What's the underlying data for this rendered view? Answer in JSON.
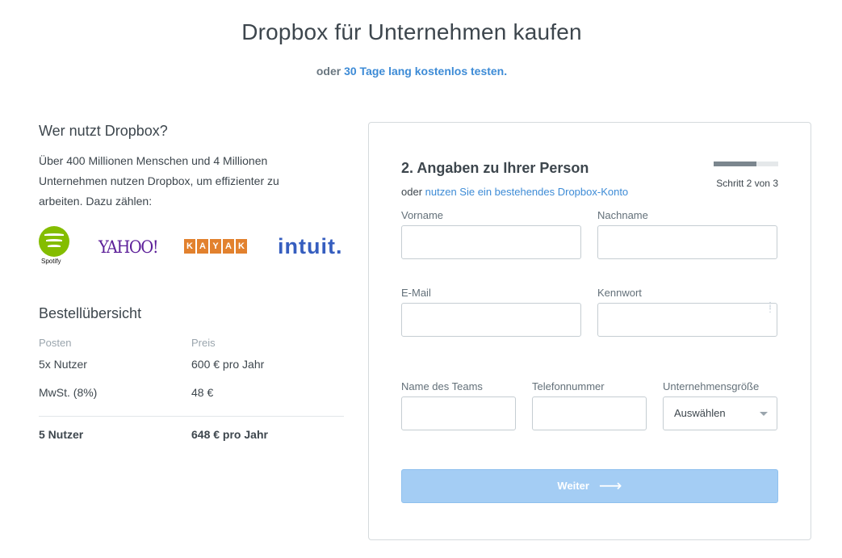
{
  "header": {
    "title": "Dropbox für Unternehmen kaufen",
    "subtitle_prefix": "oder",
    "subtitle_link": "30 Tage lang kostenlos testen."
  },
  "who": {
    "title": "Wer nutzt Dropbox?",
    "text": "Über 400 Millionen Menschen und 4 Millionen Unternehmen nutzen Dropbox, um effizienter zu arbeiten. Dazu zählen:",
    "logos": {
      "spotify": "Spotify",
      "yahoo": "YAHOO!",
      "kayak": [
        "K",
        "A",
        "Y",
        "A",
        "K"
      ],
      "intuit": "intuit."
    }
  },
  "order": {
    "title": "Bestellübersicht",
    "head_item": "Posten",
    "head_price": "Preis",
    "rows": [
      {
        "item": "5x Nutzer",
        "price": "600 € pro Jahr"
      },
      {
        "item": "MwSt. (8%)",
        "price": "48 €"
      }
    ],
    "total_item": "5 Nutzer",
    "total_price": "648 € pro Jahr"
  },
  "form": {
    "title": "2. Angaben zu Ihrer Person",
    "sub_prefix": "oder",
    "sub_link": "nutzen Sie ein bestehendes Dropbox-Konto",
    "progress_fraction": 0.667,
    "step_text": "Schritt 2 von 3",
    "first_name_label": "Vorname",
    "last_name_label": "Nachname",
    "email_label": "E-Mail",
    "password_label": "Kennwort",
    "team_label": "Name des Teams",
    "phone_label": "Telefonnummer",
    "size_label": "Unternehmensgröße",
    "size_value": "Auswählen",
    "submit_label": "Weiter",
    "submit_arrow": "⟶"
  },
  "colors": {
    "link": "#3d8bd6",
    "button": "#a4cdf4",
    "spotify": "#84bd00",
    "yahoo": "#5c1f99",
    "kayak": "#e2812e",
    "intuit": "#365ebf"
  }
}
